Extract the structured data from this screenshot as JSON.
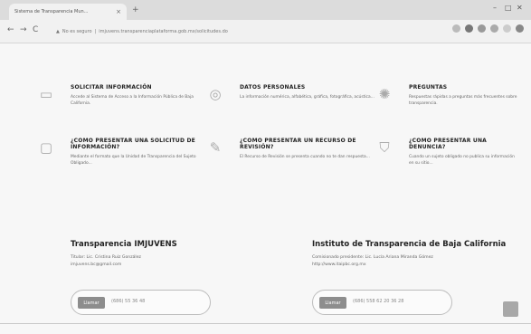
{
  "browser": {
    "tab_title": "Sistema de Transparencia Mun...",
    "tab_close": "×",
    "new_tab": "+",
    "window_controls": [
      "–",
      "□",
      "✕"
    ],
    "nav": [
      "←",
      "→",
      "C"
    ],
    "security_label": "No es seguro",
    "url": "imjuvens.transparenciaplataforma.gob.mx/solicitudes.do"
  },
  "features": [
    {
      "icon": "form-icon",
      "title": "SOLICITAR INFORMACIÓN",
      "text": "Accede al Sistema de Acceso a la Información Pública de Baja California."
    },
    {
      "icon": "data-icon",
      "title": "DATOS PERSONALES",
      "text": "La información numérica, alfabética, gráfica, fotográfica, acústica..."
    },
    {
      "icon": "question-icon",
      "title": "PREGUNTAS",
      "text": "Respuestas rápidas a preguntas más frecuentes sobre transparencia."
    },
    {
      "icon": "chat-icon",
      "title": "¿COMO PRESENTAR UNA SOLICITUD DE INFORMACIÓN?",
      "text": "Mediante el formato que la Unidad de Transparencia del Sujeto Obligado..."
    },
    {
      "icon": "pencil-icon",
      "title": "¿COMO PRESENTAR UN RECURSO DE REVISIÓN?",
      "text": "El Recurso de Revisión se presenta cuando no te dan respuesta..."
    },
    {
      "icon": "shield-icon",
      "title": "¿COMO PRESENTAR UNA DENUNCIA?",
      "text": "Cuando un sujeto obligado no publica su información en su sitio..."
    }
  ],
  "contacts": [
    {
      "title": "Transparencia IMJUVENS",
      "lines": [
        "Titular: Lic. Cristina Ruiz González",
        "imjuvens.bc@gmail.com"
      ],
      "button": "Llamar",
      "phone": "(686) 55 36 48"
    },
    {
      "title": "Instituto de Transparencia de Baja California",
      "lines": [
        "Comisionado presidente: Lic. Lucía Ariana Miranda Gómez",
        "http://www.itaipbc.org.mx"
      ],
      "button": "Llamar",
      "phone": "(686) 558 62 20 36 28"
    }
  ]
}
